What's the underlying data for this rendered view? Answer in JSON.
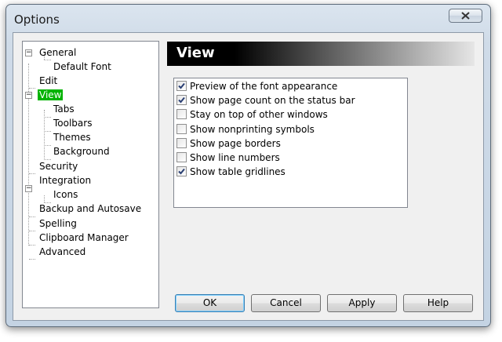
{
  "window": {
    "title": "Options"
  },
  "tree": {
    "items": [
      {
        "label": "General"
      },
      {
        "label": "Default Font"
      },
      {
        "label": "Edit"
      },
      {
        "label": "View"
      },
      {
        "label": "Tabs"
      },
      {
        "label": "Toolbars"
      },
      {
        "label": "Themes"
      },
      {
        "label": "Background"
      },
      {
        "label": "Security"
      },
      {
        "label": "Integration"
      },
      {
        "label": "Icons"
      },
      {
        "label": "Backup and Autosave"
      },
      {
        "label": "Spelling"
      },
      {
        "label": "Clipboard Manager"
      },
      {
        "label": "Advanced"
      }
    ],
    "selected": "View"
  },
  "panel": {
    "title": "View",
    "options": [
      {
        "label": "Preview of the font appearance",
        "checked": true
      },
      {
        "label": "Show page count on the status bar",
        "checked": true
      },
      {
        "label": "Stay on top of other windows",
        "checked": false
      },
      {
        "label": "Show nonprinting symbols",
        "checked": false
      },
      {
        "label": "Show page borders",
        "checked": false
      },
      {
        "label": "Show line numbers",
        "checked": false
      },
      {
        "label": "Show table gridlines",
        "checked": true
      }
    ]
  },
  "buttons": {
    "ok": "OK",
    "cancel": "Cancel",
    "apply": "Apply",
    "help": "Help"
  },
  "colors": {
    "selection": "#00b300",
    "header_bg": "#000000"
  },
  "icons": {
    "close": "close-icon",
    "expand": "minus-toggle-icon"
  }
}
